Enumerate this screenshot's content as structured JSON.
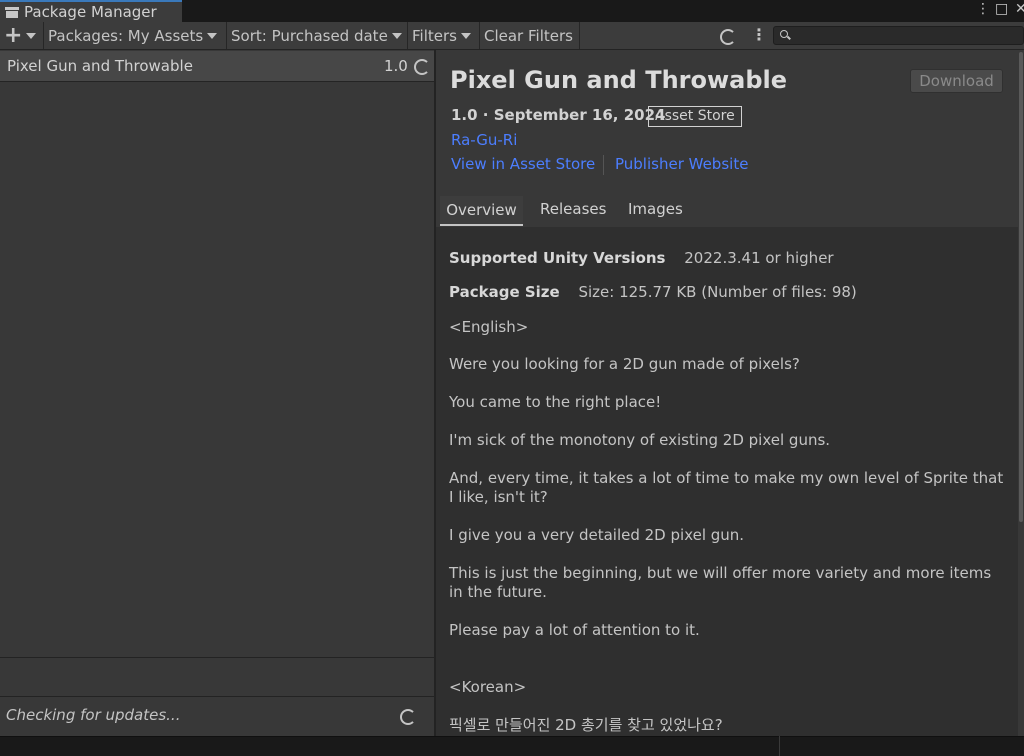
{
  "window": {
    "tab_title": "Package Manager",
    "controls": [
      "⋮",
      "□",
      "✕"
    ]
  },
  "toolbar": {
    "add_label": "+",
    "packages_dropdown": "Packages: My Assets",
    "sort_dropdown": "Sort: Purchased date",
    "filters_dropdown": "Filters",
    "clear_filters": "Clear Filters",
    "more_label": "⋮",
    "search_placeholder": ""
  },
  "package_list": {
    "items": [
      {
        "name": "Pixel Gun and Throwable",
        "version": "1.0"
      }
    ],
    "status_text": "Checking for updates..."
  },
  "details": {
    "title": "Pixel Gun and Throwable",
    "download_label": "Download",
    "version_date": "1.0 · September 16, 2024",
    "source_badge": "Asset Store",
    "author": "Ra-Gu-Ri",
    "links": {
      "view_store": "View in Asset Store",
      "publisher": "Publisher Website"
    },
    "tabs": [
      "Overview",
      "Releases",
      "Images"
    ],
    "active_tab": "Overview",
    "supported_label": "Supported Unity Versions",
    "supported_value": "2022.3.41 or higher",
    "size_label": "Package Size",
    "size_value": "Size: 125.77 KB (Number of files: 98)",
    "description": [
      "<English>",
      "Were you looking for a 2D gun made of pixels?",
      "You came to the right place!",
      "I'm sick of the monotony of existing 2D pixel guns.",
      "And, every time, it takes a lot of time to make my own level of Sprite that I like, isn't it?",
      "I give you a very detailed 2D pixel gun.",
      "This is just the beginning, but we will offer more variety and more items in the future.",
      "Please pay a lot of attention to it.",
      "<Korean>",
      "픽셀로 만들어진 2D 총기를 찾고 있었나요?"
    ]
  },
  "colors": {
    "background": "#282828",
    "panel": "#383838",
    "link": "#4c7eff",
    "accent_tab": "#3a79bb"
  }
}
